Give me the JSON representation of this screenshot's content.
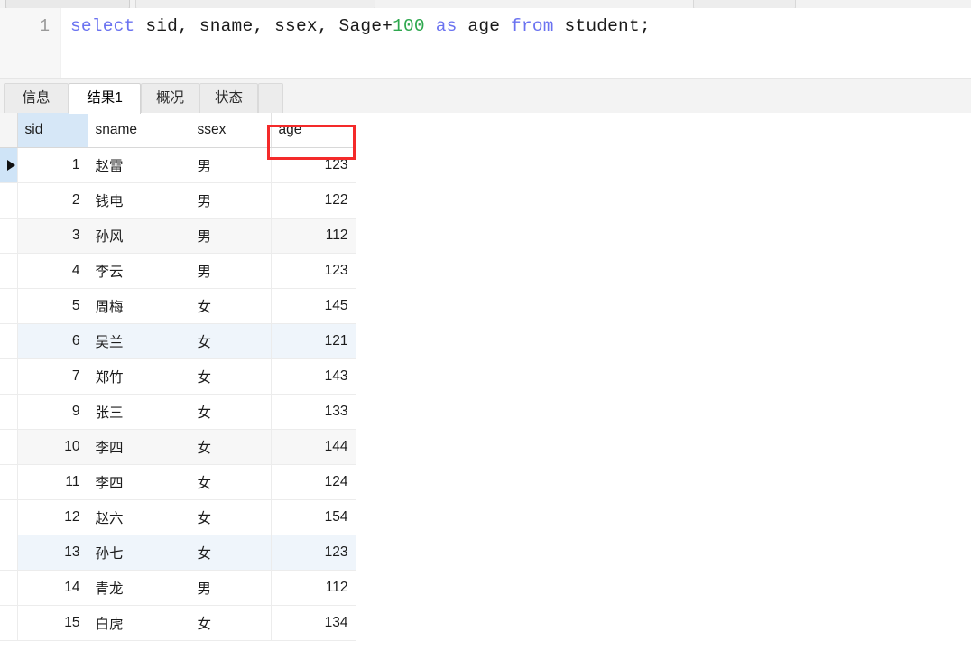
{
  "app": {
    "editor": {
      "line_number": "1",
      "sql_tokens": [
        {
          "text": "select",
          "type": "keyword"
        },
        {
          "text": " sid, sname, ssex, Sage+",
          "type": "plain"
        },
        {
          "text": "100",
          "type": "number"
        },
        {
          "text": " ",
          "type": "plain"
        },
        {
          "text": "as",
          "type": "keyword"
        },
        {
          "text": " age ",
          "type": "plain"
        },
        {
          "text": "from",
          "type": "keyword"
        },
        {
          "text": " student;",
          "type": "plain"
        }
      ],
      "sql_text": "select sid, sname, ssex, Sage+100 as age from student;"
    },
    "tabs": [
      {
        "label": "信息",
        "active": false
      },
      {
        "label": "结果1",
        "active": true
      },
      {
        "label": "概况",
        "active": false
      },
      {
        "label": "状态",
        "active": false
      }
    ],
    "grid": {
      "columns": [
        {
          "label": "sid",
          "align": "right",
          "selected": true
        },
        {
          "label": "sname",
          "align": "left",
          "selected": false
        },
        {
          "label": "ssex",
          "align": "left",
          "selected": false
        },
        {
          "label": "age",
          "align": "right",
          "selected": false,
          "annotated": true
        }
      ],
      "rows": [
        {
          "sid": "1",
          "sname": "赵雷",
          "ssex": "男",
          "age": "123",
          "current": true,
          "band": "none"
        },
        {
          "sid": "2",
          "sname": "钱电",
          "ssex": "男",
          "age": "122",
          "current": false,
          "band": "none"
        },
        {
          "sid": "3",
          "sname": "孙风",
          "ssex": "男",
          "age": "112",
          "current": false,
          "band": "grey"
        },
        {
          "sid": "4",
          "sname": "李云",
          "ssex": "男",
          "age": "123",
          "current": false,
          "band": "none"
        },
        {
          "sid": "5",
          "sname": "周梅",
          "ssex": "女",
          "age": "145",
          "current": false,
          "band": "none"
        },
        {
          "sid": "6",
          "sname": "吴兰",
          "ssex": "女",
          "age": "121",
          "current": false,
          "band": "blue"
        },
        {
          "sid": "7",
          "sname": "郑竹",
          "ssex": "女",
          "age": "143",
          "current": false,
          "band": "none"
        },
        {
          "sid": "9",
          "sname": "张三",
          "ssex": "女",
          "age": "133",
          "current": false,
          "band": "none"
        },
        {
          "sid": "10",
          "sname": "李四",
          "ssex": "女",
          "age": "144",
          "current": false,
          "band": "grey"
        },
        {
          "sid": "11",
          "sname": "李四",
          "ssex": "女",
          "age": "124",
          "current": false,
          "band": "none"
        },
        {
          "sid": "12",
          "sname": "赵六",
          "ssex": "女",
          "age": "154",
          "current": false,
          "band": "none"
        },
        {
          "sid": "13",
          "sname": "孙七",
          "ssex": "女",
          "age": "123",
          "current": false,
          "band": "blue"
        },
        {
          "sid": "14",
          "sname": "青龙",
          "ssex": "男",
          "age": "112",
          "current": false,
          "band": "none"
        },
        {
          "sid": "15",
          "sname": "白虎",
          "ssex": "女",
          "age": "134",
          "current": false,
          "band": "none"
        }
      ],
      "row_marker_icon": "caret-right-icon"
    },
    "annotation": {
      "shape": "rectangle",
      "color": "#f42a2a",
      "target_column": "age"
    },
    "colors": {
      "keyword": "#6a72f0",
      "number_literal": "#2fa84f",
      "selected_header": "#d6e7f7",
      "current_row_marker": "#cfe4f7",
      "annotation_red": "#f42a2a"
    }
  }
}
